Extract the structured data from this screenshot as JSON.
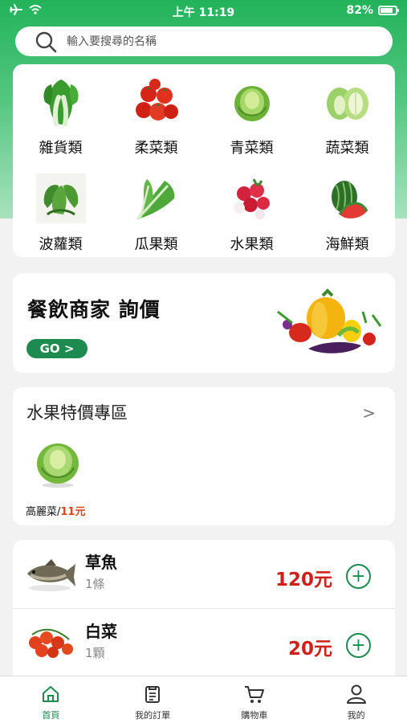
{
  "status_bar": {
    "time": "上午 11:19",
    "battery": "82%",
    "battery_level": 0.82
  },
  "search": {
    "placeholder": "輸入要搜尋的名稱"
  },
  "categories": [
    {
      "label": "雜貨類",
      "icon": "bok-choy-icon"
    },
    {
      "label": "柔菜類",
      "icon": "tomato-icon"
    },
    {
      "label": "青菜類",
      "icon": "cabbage-icon"
    },
    {
      "label": "蔬菜類",
      "icon": "napa-cabbage-icon"
    },
    {
      "label": "波蘿類",
      "icon": "spinach-icon"
    },
    {
      "label": "瓜果類",
      "icon": "greens-icon"
    },
    {
      "label": "水果類",
      "icon": "lychee-icon"
    },
    {
      "label": "海鮮類",
      "icon": "watermelon-icon"
    }
  ],
  "promo": {
    "title": "餐飲商家 詢價",
    "button": "GO >"
  },
  "special": {
    "title": "水果特價專區",
    "arrow": ">",
    "item": {
      "name": "高麗菜/",
      "price": "11元"
    }
  },
  "products": [
    {
      "name": "草魚",
      "unit": "1條",
      "price": "120元",
      "add": "+"
    },
    {
      "name": "白菜",
      "unit": "1顆",
      "price": "20元",
      "add": "+"
    }
  ],
  "tabs": [
    {
      "label": "首頁",
      "icon": "home-icon"
    },
    {
      "label": "我的訂單",
      "icon": "clipboard-icon"
    },
    {
      "label": "購物車",
      "icon": "cart-icon"
    },
    {
      "label": "我的",
      "icon": "user-icon"
    }
  ],
  "colors": {
    "brand_green": "#1d8b4f",
    "price_red": "#d0201a",
    "header_green": "#22b35a"
  }
}
